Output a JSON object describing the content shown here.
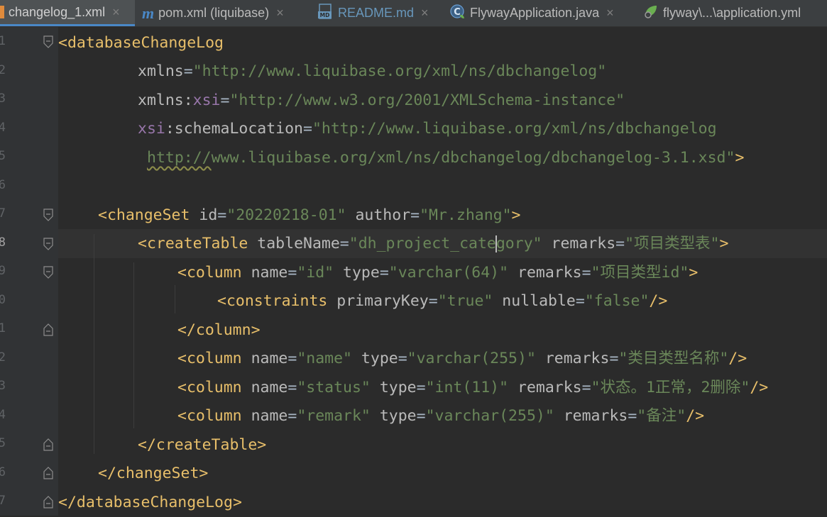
{
  "tabs": [
    {
      "label": "changelog_1.xml",
      "icon": "xml-file-icon",
      "active": true
    },
    {
      "label": "pom.xml (liquibase)",
      "icon": "maven-icon"
    },
    {
      "label": "README.md",
      "icon": "markdown-icon",
      "badge": "MD"
    },
    {
      "label": "FlywayApplication.java",
      "icon": "spring-class-icon"
    },
    {
      "label": "flyway\\...\\application.yml",
      "icon": "spring-leaf-icon"
    }
  ],
  "maven_glyph": "m",
  "close_glyph": "×",
  "line_numbers": [
    "1",
    "2",
    "3",
    "4",
    "5",
    "6",
    "7",
    "8",
    "9",
    "0",
    "1",
    "2",
    "3",
    "4",
    "5",
    "6",
    "7",
    "8"
  ],
  "code": {
    "l1": {
      "open": "<",
      "tag": "databaseChangeLog"
    },
    "l2": {
      "attr": "xmlns",
      "eq": "=",
      "val": "\"http://www.liquibase.org/xml/ns/dbchangelog\""
    },
    "l3": {
      "attr": "xmlns:",
      "ns": "xsi",
      "eq": "=",
      "val": "\"http://www.w3.org/2001/XMLSchema-instance\""
    },
    "l4": {
      "ns": "xsi",
      "attr": ":schemaLocation",
      "eq": "=",
      "val": "\"http://www.liquibase.org/xml/ns/dbchangelog"
    },
    "l5": {
      "val_a": "http://",
      "val_b": "www.liquibase.org/xml/ns/dbchangelog/dbchangelog-3.1.xsd\"",
      "close": ">"
    },
    "l7": {
      "open": "<",
      "tag": "changeSet",
      "a1": " id",
      "eq": "=",
      "v1": "\"20220218-01\"",
      "a2": " author",
      "v2": "\"Mr.zhang\"",
      "close": ">"
    },
    "l8": {
      "open": "<",
      "tag": "createTable",
      "a1": " tableName",
      "eq": "=",
      "v1a": "\"dh_project_cate",
      "v1b": "gory\"",
      "a2": " remarks",
      "v2": "\"项目类型表\"",
      "close": ">"
    },
    "l9": {
      "open": "<",
      "tag": "column",
      "a1": " name",
      "eq": "=",
      "v1": "\"id\"",
      "a2": " type",
      "v2": "\"varchar(64)\"",
      "a3": " remarks",
      "v3": "\"项目类型id\"",
      "close": ">"
    },
    "l10": {
      "open": "<",
      "tag": "constraints",
      "a1": " primaryKey",
      "eq": "=",
      "v1": "\"true\"",
      "a2": " nullable",
      "v2": "\"false\"",
      "close": "/>"
    },
    "l11": {
      "open": "</",
      "tag": "column",
      "close": ">"
    },
    "l12": {
      "open": "<",
      "tag": "column",
      "a1": " name",
      "eq": "=",
      "v1": "\"name\"",
      "a2": " type",
      "v2": "\"varchar(255)\"",
      "a3": " remarks",
      "v3": "\"类目类型名称\"",
      "close": "/>"
    },
    "l13": {
      "open": "<",
      "tag": "column",
      "a1": " name",
      "eq": "=",
      "v1": "\"status\"",
      "a2": " type",
      "v2": "\"int(11)\"",
      "a3": " remarks",
      "v3": "\"状态。1正常，2删除\"",
      "close": "/>"
    },
    "l14": {
      "open": "<",
      "tag": "column",
      "a1": " name",
      "eq": "=",
      "v1": "\"remark\"",
      "a2": " type",
      "v2": "\"varchar(255)\"",
      "a3": " remarks",
      "v3": "\"备注\"",
      "close": "/>"
    },
    "l15": {
      "open": "</",
      "tag": "createTable",
      "close": ">"
    },
    "l16": {
      "open": "</",
      "tag": "changeSet",
      "close": ">"
    },
    "l17": {
      "open": "</",
      "tag": "databaseChangeLog",
      "close": ">"
    }
  },
  "colors": {
    "tag": "#e8bf6a",
    "attribute": "#bababa",
    "namespace": "#9876aa",
    "value": "#6a8759",
    "tab_accent": "#4a88c7",
    "background": "#2b2b2b"
  }
}
